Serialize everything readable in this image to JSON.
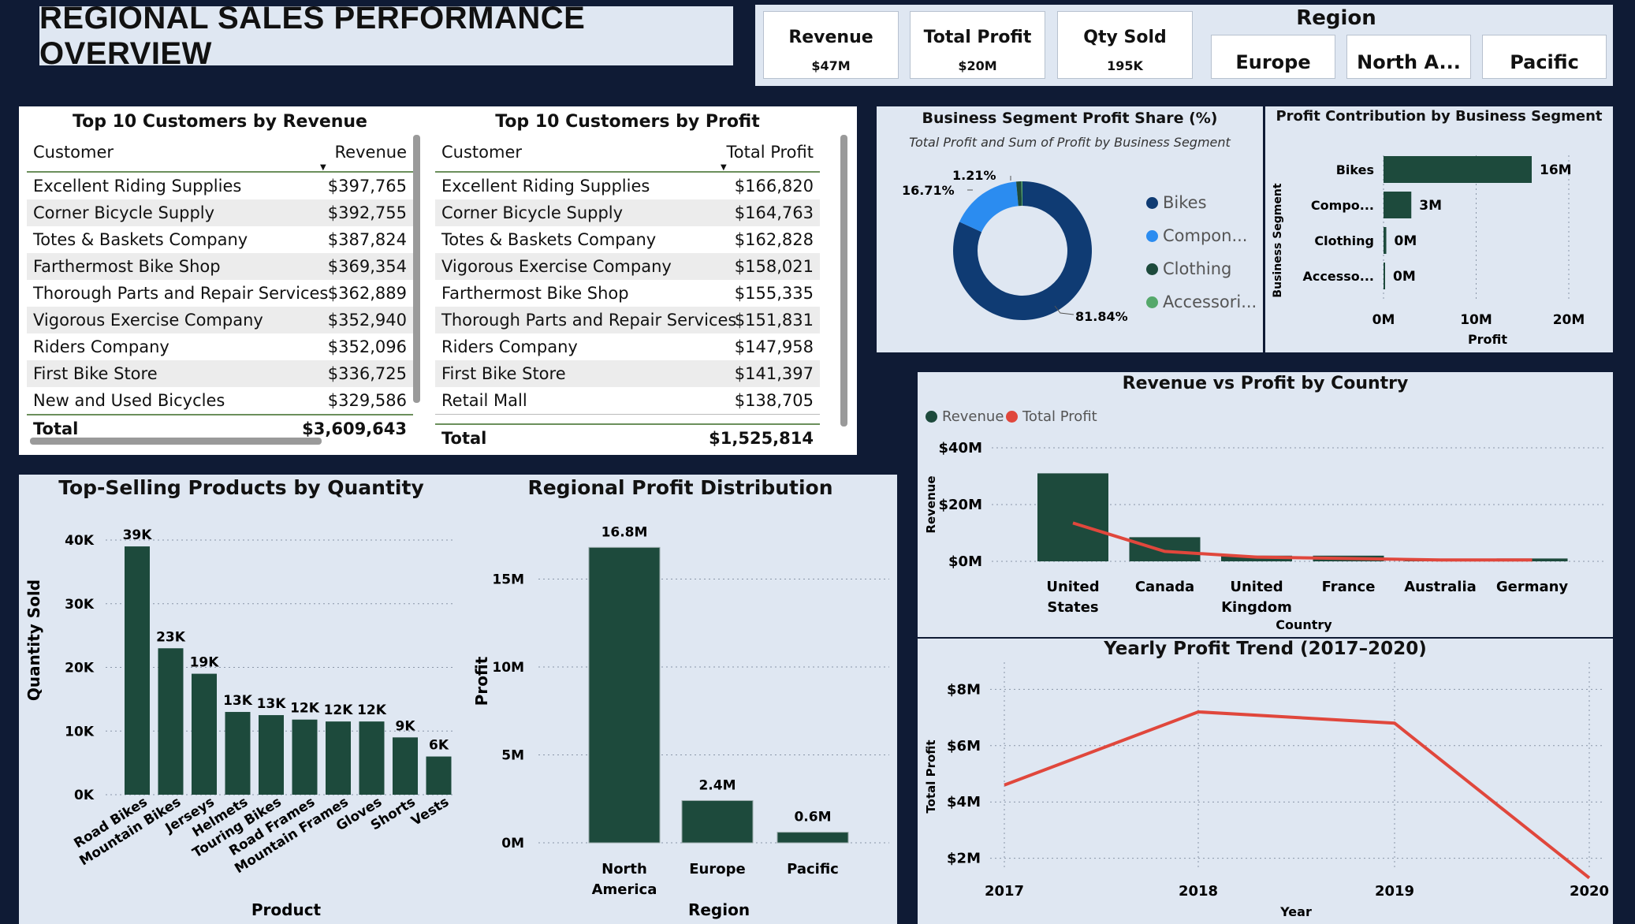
{
  "header": {
    "title": "REGIONAL SALES PERFORMANCE OVERVIEW"
  },
  "kpis": [
    {
      "label": "Revenue",
      "value": "$47M"
    },
    {
      "label": "Total Profit",
      "value": "$20M"
    },
    {
      "label": "Qty Sold",
      "value": "195K"
    }
  ],
  "region_slicer": {
    "title": "Region",
    "options": [
      "Europe",
      "North A...",
      "Pacific"
    ]
  },
  "table_revenue": {
    "title": "Top 10 Customers by Revenue",
    "col1": "Customer",
    "col2": "Revenue",
    "rows": [
      [
        "Excellent Riding Supplies",
        "$397,765"
      ],
      [
        "Corner Bicycle Supply",
        "$392,755"
      ],
      [
        "Totes & Baskets Company",
        "$387,824"
      ],
      [
        "Farthermost Bike Shop",
        "$369,354"
      ],
      [
        "Thorough Parts and Repair Services",
        "$362,889"
      ],
      [
        "Vigorous Exercise Company",
        "$352,940"
      ],
      [
        "Riders Company",
        "$352,096"
      ],
      [
        "First Bike Store",
        "$336,725"
      ],
      [
        "New and Used Bicycles",
        "$329,586"
      ]
    ],
    "total_label": "Total",
    "total_value": "$3,609,643"
  },
  "table_profit": {
    "title": "Top 10 Customers by Profit",
    "col1": "Customer",
    "col2": "Total Profit",
    "rows": [
      [
        "Excellent Riding Supplies",
        "$166,820"
      ],
      [
        "Corner Bicycle Supply",
        "$164,763"
      ],
      [
        "Totes & Baskets Company",
        "$162,828"
      ],
      [
        "Vigorous Exercise Company",
        "$158,021"
      ],
      [
        "Farthermost Bike Shop",
        "$155,335"
      ],
      [
        "Thorough Parts and Repair Services",
        "$151,831"
      ],
      [
        "Riders Company",
        "$147,958"
      ],
      [
        "First Bike Store",
        "$141,397"
      ],
      [
        "Retail Mall",
        "$138,705"
      ]
    ],
    "total_label": "Total",
    "total_value": "$1,525,814"
  },
  "segment_share": {
    "title": "Business Segment Profit Share (%)",
    "subtitle": "Total Profit and Sum of Profit by Business Segment",
    "legend": [
      "Bikes",
      "Compon...",
      "Clothing",
      "Accessori..."
    ],
    "colors": {
      "Bikes": "#0f3b73",
      "Components": "#2b8cf0",
      "Clothing": "#1d4a3c",
      "Accessories": "#55a86b"
    }
  },
  "segment_bar": {
    "title": "Profit Contribution by Business Segment",
    "xlabel": "Profit",
    "ylabel": "Business Segment"
  },
  "top_products": {
    "title": "Top-Selling Products by Quantity",
    "xlabel": "Product",
    "ylabel": "Quantity Sold"
  },
  "regional_profit": {
    "title": "Regional Profit Distribution",
    "xlabel": "Region",
    "ylabel": "Profit"
  },
  "rev_vs_profit": {
    "title": "Revenue vs Profit by Country",
    "legend": [
      "Revenue",
      "Total Profit"
    ],
    "xlabel": "Country",
    "ylabel": "Revenue"
  },
  "yearly_trend": {
    "title": "Yearly Profit Trend (2017–2020)",
    "xlabel": "Year",
    "ylabel": "Total Profit"
  },
  "colors": {
    "bar": "#1d4a3c",
    "line": "#e0473c",
    "panel": "#dfe7f2",
    "page": "#0f1b35"
  },
  "chart_data": [
    {
      "type": "pie",
      "name": "segment_share",
      "labels": [
        "Bikes",
        "Components",
        "Clothing",
        "Accessories"
      ],
      "values": [
        81.84,
        16.71,
        1.21,
        0.24
      ],
      "value_labels": [
        "81.84%",
        "16.71%",
        "1.21%",
        ""
      ]
    },
    {
      "type": "bar",
      "name": "segment_bar",
      "orientation": "horizontal",
      "categories": [
        "Bikes",
        "Compo...",
        "Clothing",
        "Accesso..."
      ],
      "values": [
        16,
        3,
        0.3,
        0.05
      ],
      "value_labels": [
        "16M",
        "3M",
        "0M",
        "0M"
      ],
      "xticks": [
        "0M",
        "10M",
        "20M"
      ],
      "xlim": [
        0,
        20
      ]
    },
    {
      "type": "bar",
      "name": "top_products",
      "categories": [
        "Road Bikes",
        "Mountain Bikes",
        "Jerseys",
        "Helmets",
        "Touring Bikes",
        "Road Frames",
        "Mountain Frames",
        "Gloves",
        "Shorts",
        "Vests"
      ],
      "values": [
        39,
        23,
        19,
        13,
        12.5,
        11.8,
        11.5,
        11.5,
        9,
        6
      ],
      "value_labels": [
        "39K",
        "23K",
        "19K",
        "13K",
        "13K",
        "12K",
        "12K",
        "12K",
        "9K",
        "6K"
      ],
      "yticks": [
        "0K",
        "10K",
        "20K",
        "30K",
        "40K"
      ],
      "ylim": [
        0,
        40
      ]
    },
    {
      "type": "bar",
      "name": "regional_profit",
      "categories": [
        "North America",
        "Europe",
        "Pacific"
      ],
      "values": [
        16.8,
        2.4,
        0.6
      ],
      "value_labels": [
        "16.8M",
        "2.4M",
        "0.6M"
      ],
      "yticks": [
        "0M",
        "5M",
        "10M",
        "15M"
      ],
      "ylim": [
        0,
        18
      ]
    },
    {
      "type": "bar",
      "name": "rev_vs_profit",
      "categories": [
        "United States",
        "Canada",
        "United Kingdom",
        "France",
        "Australia",
        "Germany"
      ],
      "series": [
        {
          "name": "Revenue",
          "values": [
            31,
            8.5,
            2,
            2,
            0.5,
            1
          ],
          "kind": "bar"
        },
        {
          "name": "Total Profit",
          "values": [
            13.5,
            3.5,
            1.5,
            1,
            0.5,
            0.5
          ],
          "kind": "line"
        }
      ],
      "yticks": [
        "$0M",
        "$20M",
        "$40M"
      ],
      "ylim": [
        0,
        40
      ]
    },
    {
      "type": "line",
      "name": "yearly_trend",
      "categories": [
        "2017",
        "2018",
        "2019",
        "2020"
      ],
      "values": [
        4.6,
        7.2,
        6.8,
        1.3
      ],
      "yticks": [
        "$2M",
        "$4M",
        "$6M",
        "$8M"
      ],
      "ylim": [
        1,
        8.5
      ]
    }
  ]
}
